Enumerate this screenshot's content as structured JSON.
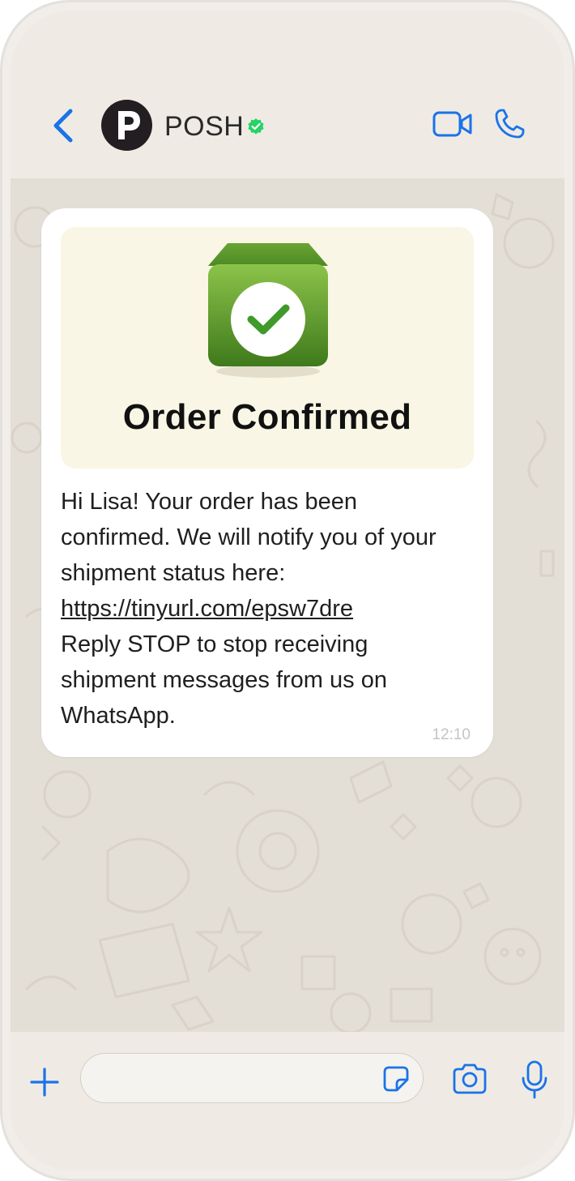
{
  "header": {
    "back_icon": "chevron-left-icon",
    "avatar_letter": "P",
    "contact_name": "POSH",
    "verified_icon": "verified-badge-icon",
    "video_icon": "video-call-icon",
    "call_icon": "phone-call-icon"
  },
  "message": {
    "media_title": "Order Confirmed",
    "media_icon": "box-check-icon",
    "lines": [
      "Hi Lisa! Your order has been confirmed. We will notify you of your shipment status here:"
    ],
    "link": "https://tinyurl.com/epsw7dre",
    "footer_text": "Reply STOP to stop receiving shipment messages from us on WhatsApp.",
    "time": "12:10"
  },
  "input_bar": {
    "plus_icon": "plus-icon",
    "input_value": "",
    "sticker_icon": "sticker-icon",
    "camera_icon": "camera-icon",
    "mic_icon": "microphone-icon"
  },
  "colors": {
    "accent": "#1a73e8",
    "verified": "#25d366",
    "header_bg": "#efebe4",
    "chat_bg": "#e3ded6",
    "media_bg": "#faf6e6",
    "box_green": "#5a9a2c"
  }
}
